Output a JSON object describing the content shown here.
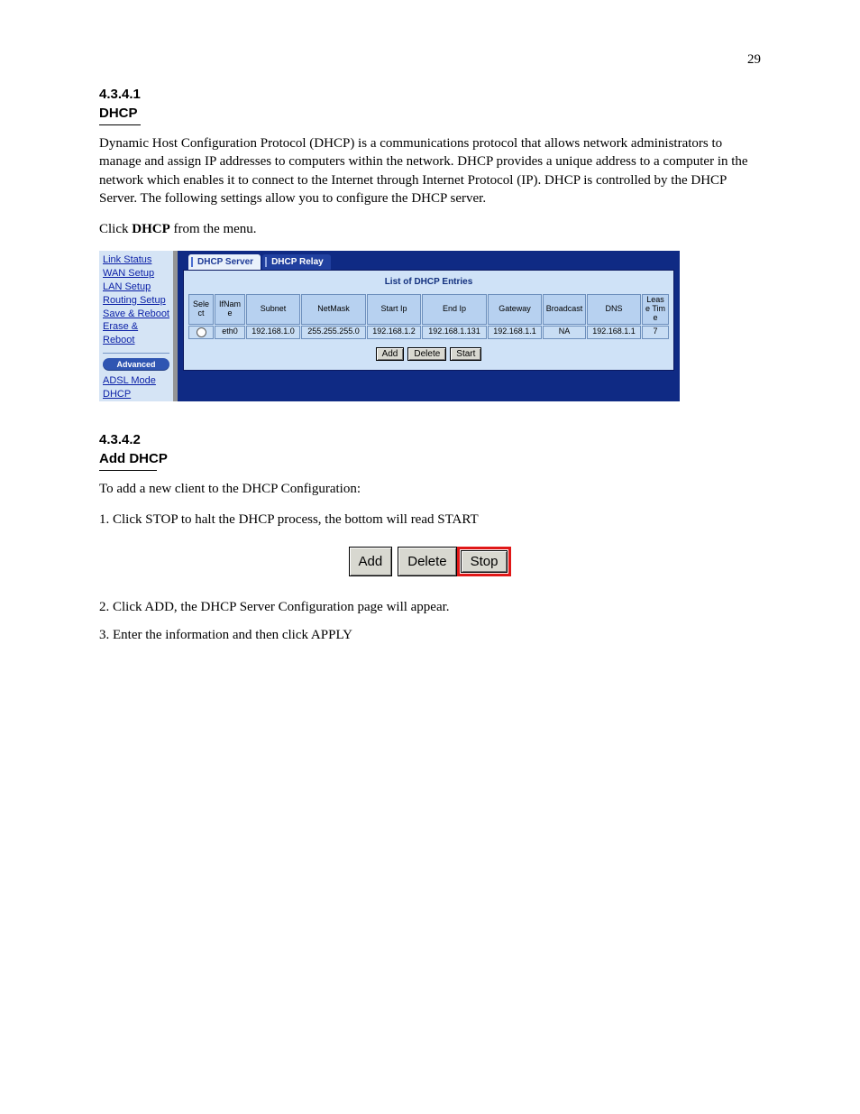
{
  "page": {
    "number": "29"
  },
  "section1": {
    "label": "4.3.4.1",
    "name": "DHCP",
    "para": "Dynamic Host Configuration Protocol (DHCP) is a communications protocol that allows network administrators to manage and assign IP addresses to computers within the network. DHCP provides a unique address to a computer in the network which enables it to connect to the Internet through Internet Protocol (IP). DHCP is controlled by the DHCP Server. The following settings allow you to configure the DHCP server.",
    "click_text_prefix": "Click ",
    "click_link": "DHCP",
    "click_text_suffix": " from the menu."
  },
  "router": {
    "sidebar": {
      "items": [
        "Link Status",
        "WAN Setup",
        "LAN Setup",
        "Routing Setup",
        "Save & Reboot",
        "Erase & Reboot"
      ],
      "advanced_label": "Advanced",
      "adv_items": [
        "ADSL Mode",
        "DHCP"
      ]
    },
    "tabs": {
      "active": "DHCP Server",
      "inactive": "DHCP Relay"
    },
    "panel_title": "List of DHCP Entries",
    "table": {
      "headers": [
        "Select",
        "IfName",
        "Subnet",
        "NetMask",
        "Start Ip",
        "End Ip",
        "Gateway",
        "Broadcast",
        "DNS",
        "Lease Time"
      ],
      "row": {
        "ifname": "eth0",
        "subnet": "192.168.1.0",
        "netmask": "255.255.255.0",
        "startip": "192.168.1.2",
        "endip": "192.168.1.131",
        "gateway": "192.168.1.1",
        "broadcast": "NA",
        "dns": "192.168.1.1",
        "lease": "7"
      }
    },
    "buttons": {
      "add": "Add",
      "del": "Delete",
      "start": "Start"
    }
  },
  "section2": {
    "label": "4.3.4.2",
    "name": "Add DHCP",
    "intro": "To add a new client to the DHCP Configuration:",
    "step_pre": "1. Click STOP to halt the DHCP process, the bottom will read START",
    "btnset": {
      "add": "Add",
      "del": "Delete",
      "stop": "Stop"
    },
    "step_post_1": "2. Click ADD, the DHCP Server Configuration page will appear.",
    "step_post_2": "3. Enter the information and then click APPLY"
  }
}
